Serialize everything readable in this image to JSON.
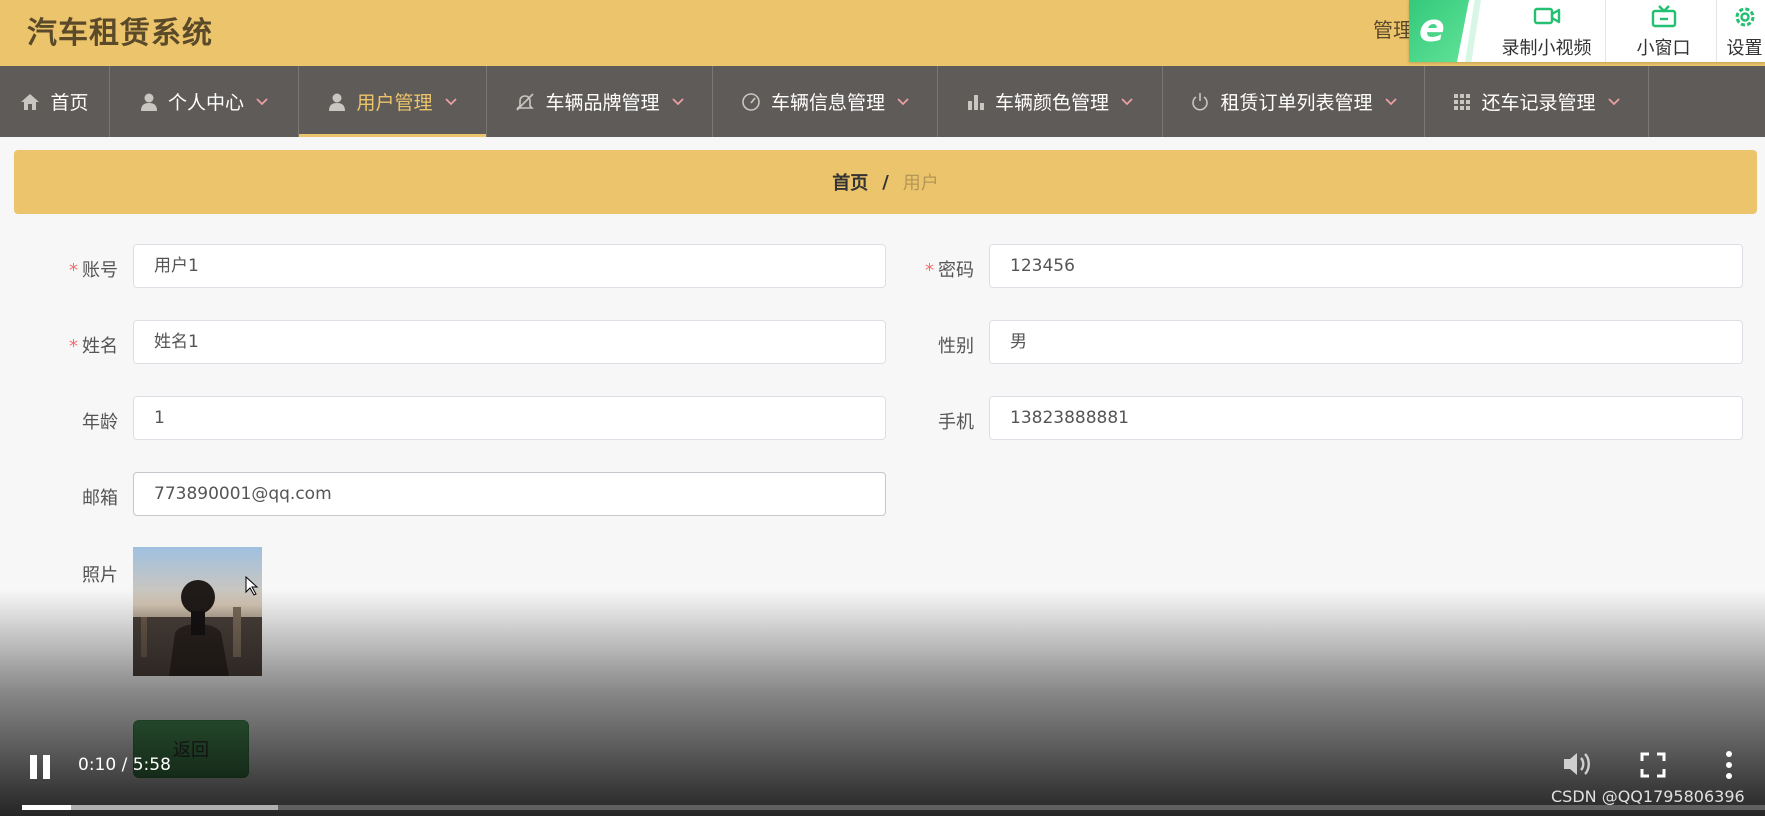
{
  "header": {
    "app_title": "汽车租赁系统",
    "admin_text": "管理"
  },
  "browser_toolbar": {
    "logo_letter": "e",
    "record_label": "录制小视频",
    "mini_window_label": "小窗口",
    "settings_label": "设置",
    "accent_color": "#22c070"
  },
  "nav": {
    "items": [
      {
        "label": "首页",
        "icon": "home-icon"
      },
      {
        "label": "个人中心",
        "icon": "user-icon"
      },
      {
        "label": "用户管理",
        "icon": "user-icon",
        "active": true
      },
      {
        "label": "车辆品牌管理",
        "icon": "bell-icon"
      },
      {
        "label": "车辆信息管理",
        "icon": "gauge-icon"
      },
      {
        "label": "车辆颜色管理",
        "icon": "bar-chart-icon"
      },
      {
        "label": "租赁订单列表管理",
        "icon": "power-icon"
      },
      {
        "label": "还车记录管理",
        "icon": "grid-icon"
      }
    ],
    "active_color": "#ecc46b"
  },
  "breadcrumb": {
    "home": "首页",
    "separator": "/",
    "current": "用户"
  },
  "form": {
    "account_label": "账号",
    "account_value": "用户1",
    "password_label": "密码",
    "password_value": "123456",
    "name_label": "姓名",
    "name_value": "姓名1",
    "gender_label": "性别",
    "gender_value": "男",
    "age_label": "年龄",
    "age_value": "1",
    "phone_label": "手机",
    "phone_value": "13823888881",
    "email_label": "邮箱",
    "email_value": "773890001@qq.com",
    "photo_label": "照片",
    "required_mark": "*",
    "back_label": "返回"
  },
  "video": {
    "time": "0:10 / 5:58",
    "progress_played": 0.028,
    "progress_buffered": 0.147,
    "watermark": "CSDN @QQ1795806396"
  },
  "colors": {
    "header_bg": "#ecc46b",
    "nav_bg": "#5f5b58",
    "required": "#f56c6c"
  }
}
